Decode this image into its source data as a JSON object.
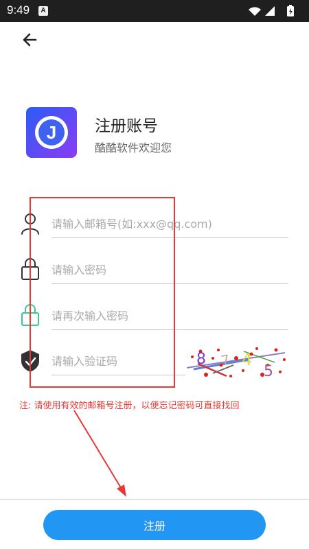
{
  "status_bar": {
    "time": "9:49",
    "notification_badge": "A"
  },
  "header": {
    "back_icon": "arrow-left-icon"
  },
  "app": {
    "logo_letter": "J",
    "title": "注册账号",
    "subtitle": "酷酷软件欢迎您"
  },
  "form": {
    "email": {
      "placeholder": "请输入邮箱号(如:xxx@qq.com)",
      "value": "",
      "icon": "user-icon"
    },
    "password": {
      "placeholder": "请输入密码",
      "value": "",
      "icon": "lock-icon"
    },
    "confirm_password": {
      "placeholder": "请再次输入密码",
      "value": "",
      "icon": "lock-green-icon"
    },
    "captcha": {
      "placeholder": "请输入验证码",
      "value": "",
      "icon": "shield-icon",
      "image_chars": [
        "8",
        "7",
        "4",
        "5"
      ]
    }
  },
  "note": "注: 请使用有效的邮箱号注册，以便忘记密码可直接找回",
  "register_button": "注册",
  "colors": {
    "primary": "#2196f3",
    "annotation": "#e53935",
    "logo_gradient": [
      "#2b5cf5",
      "#8b3cf5"
    ]
  }
}
